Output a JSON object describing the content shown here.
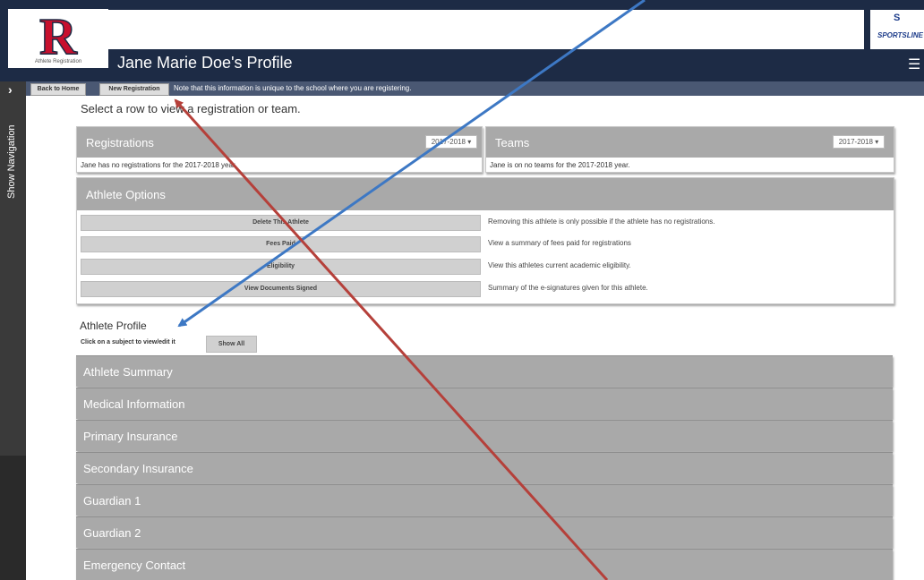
{
  "header": {
    "logo_caption": "Athlete Registration",
    "profile_title": "Jane Marie Doe's Profile",
    "sponsor_name": "SPORTSLINE",
    "sponsor_glyph": "S"
  },
  "toolbar": {
    "back_label": "Back to Home",
    "new_registration_label": "New Registration",
    "note": "Note that this information is unique to the school where you are registering."
  },
  "side_nav": {
    "label": "Show Navigation"
  },
  "main": {
    "select_prompt": "Select a row to view a registration or team.",
    "registrations": {
      "title": "Registrations",
      "year": "2017-2018",
      "empty_text": "Jane has no registrations for the 2017-2018 year."
    },
    "teams": {
      "title": "Teams",
      "year": "2017-2018",
      "empty_text": "Jane is on no teams for the 2017-2018 year."
    },
    "athlete_options": {
      "title": "Athlete Options",
      "items": [
        {
          "label": "Delete This Athlete",
          "description": "Removing this athlete is only possible if the athlete has no registrations."
        },
        {
          "label": "Fees Paid",
          "description": "View a summary of fees paid for registrations"
        },
        {
          "label": "Eligibility",
          "description": "View this athletes current academic eligibility."
        },
        {
          "label": "View Documents Signed",
          "description": "Summary of the e-signatures given for this athlete."
        }
      ]
    },
    "athlete_profile": {
      "title": "Athlete Profile",
      "hint": "Click on a subject to view/edit it",
      "show_all_label": "Show All",
      "sections": [
        "Athlete Summary",
        "Medical Information",
        "Primary Insurance",
        "Secondary Insurance",
        "Guardian 1",
        "Guardian 2",
        "Emergency Contact"
      ]
    }
  },
  "colors": {
    "header_navy": "#1d2b45",
    "toolbar_slate": "#4a5873",
    "panel_gray": "#a9a9a9",
    "logo_red": "#c8102e",
    "arrow_blue": "#3d78c4",
    "arrow_red": "#b5403a"
  },
  "icons": [
    "chevron-right-icon",
    "hamburger-menu-icon",
    "dropdown-caret-icon"
  ]
}
